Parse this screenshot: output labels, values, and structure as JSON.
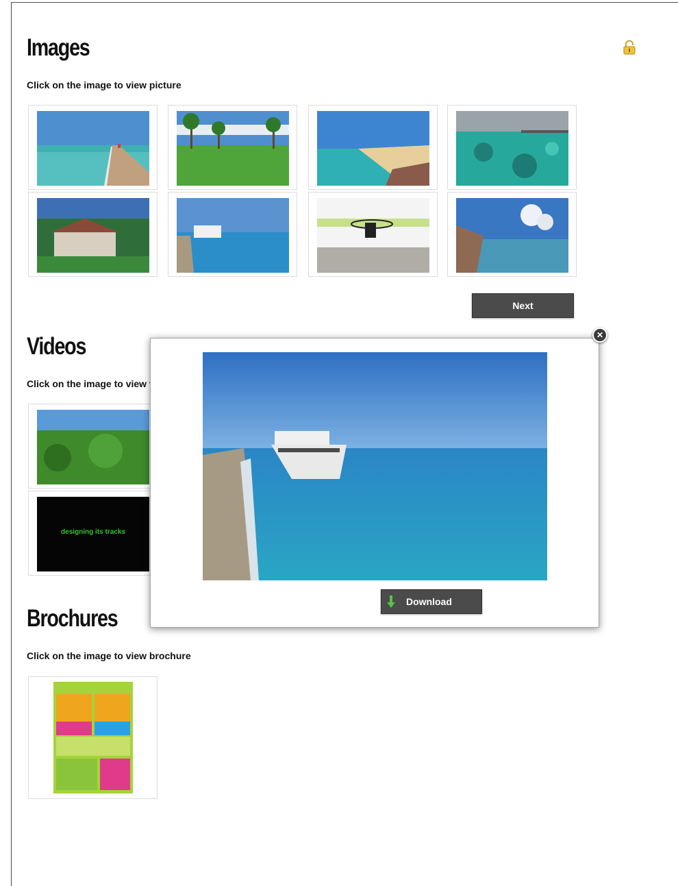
{
  "images": {
    "title": "Images",
    "instruction": "Click on the image to view picture",
    "next_label": "Next"
  },
  "videos": {
    "title": "Videos",
    "instruction": "Click on the image to view video",
    "video2_caption": "designing its tracks"
  },
  "brochures": {
    "title": "Brochures",
    "instruction": "Click on the image to view brochure"
  },
  "lightbox": {
    "download_label": "Download",
    "close_glyph": "✕"
  },
  "icons": {
    "lock": "lock-icon",
    "close": "close-icon",
    "download": "download-arrow-icon"
  },
  "colors": {
    "button_bg": "#4b4b4b",
    "video_text": "#37c22b",
    "brochure_bg": "#a6d23a"
  }
}
